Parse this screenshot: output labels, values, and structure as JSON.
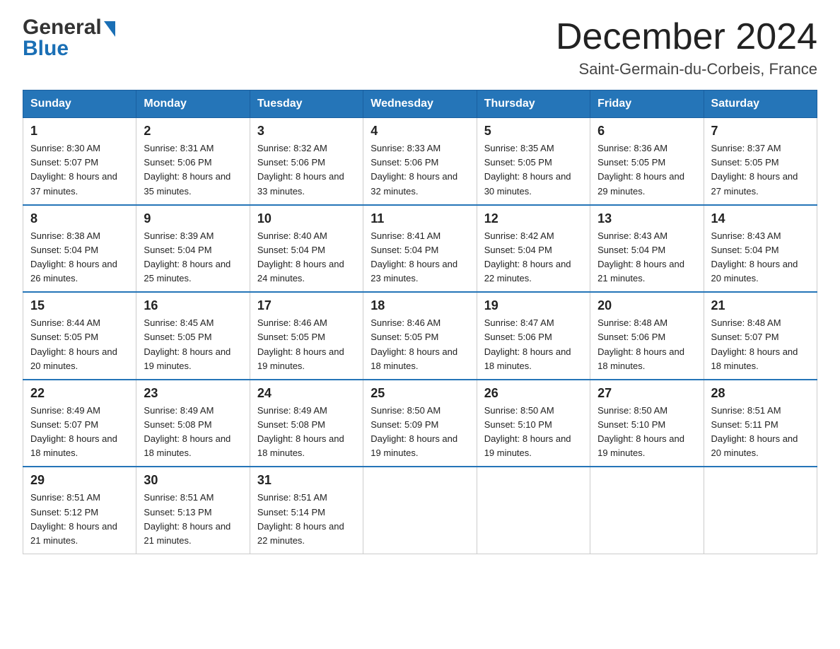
{
  "logo": {
    "text_general": "General",
    "text_blue": "Blue",
    "arrow": "▶"
  },
  "title": "December 2024",
  "location": "Saint-Germain-du-Corbeis, France",
  "days_of_week": [
    "Sunday",
    "Monday",
    "Tuesday",
    "Wednesday",
    "Thursday",
    "Friday",
    "Saturday"
  ],
  "weeks": [
    [
      {
        "day": "1",
        "sunrise": "8:30 AM",
        "sunset": "5:07 PM",
        "daylight": "8 hours and 37 minutes."
      },
      {
        "day": "2",
        "sunrise": "8:31 AM",
        "sunset": "5:06 PM",
        "daylight": "8 hours and 35 minutes."
      },
      {
        "day": "3",
        "sunrise": "8:32 AM",
        "sunset": "5:06 PM",
        "daylight": "8 hours and 33 minutes."
      },
      {
        "day": "4",
        "sunrise": "8:33 AM",
        "sunset": "5:06 PM",
        "daylight": "8 hours and 32 minutes."
      },
      {
        "day": "5",
        "sunrise": "8:35 AM",
        "sunset": "5:05 PM",
        "daylight": "8 hours and 30 minutes."
      },
      {
        "day": "6",
        "sunrise": "8:36 AM",
        "sunset": "5:05 PM",
        "daylight": "8 hours and 29 minutes."
      },
      {
        "day": "7",
        "sunrise": "8:37 AM",
        "sunset": "5:05 PM",
        "daylight": "8 hours and 27 minutes."
      }
    ],
    [
      {
        "day": "8",
        "sunrise": "8:38 AM",
        "sunset": "5:04 PM",
        "daylight": "8 hours and 26 minutes."
      },
      {
        "day": "9",
        "sunrise": "8:39 AM",
        "sunset": "5:04 PM",
        "daylight": "8 hours and 25 minutes."
      },
      {
        "day": "10",
        "sunrise": "8:40 AM",
        "sunset": "5:04 PM",
        "daylight": "8 hours and 24 minutes."
      },
      {
        "day": "11",
        "sunrise": "8:41 AM",
        "sunset": "5:04 PM",
        "daylight": "8 hours and 23 minutes."
      },
      {
        "day": "12",
        "sunrise": "8:42 AM",
        "sunset": "5:04 PM",
        "daylight": "8 hours and 22 minutes."
      },
      {
        "day": "13",
        "sunrise": "8:43 AM",
        "sunset": "5:04 PM",
        "daylight": "8 hours and 21 minutes."
      },
      {
        "day": "14",
        "sunrise": "8:43 AM",
        "sunset": "5:04 PM",
        "daylight": "8 hours and 20 minutes."
      }
    ],
    [
      {
        "day": "15",
        "sunrise": "8:44 AM",
        "sunset": "5:05 PM",
        "daylight": "8 hours and 20 minutes."
      },
      {
        "day": "16",
        "sunrise": "8:45 AM",
        "sunset": "5:05 PM",
        "daylight": "8 hours and 19 minutes."
      },
      {
        "day": "17",
        "sunrise": "8:46 AM",
        "sunset": "5:05 PM",
        "daylight": "8 hours and 19 minutes."
      },
      {
        "day": "18",
        "sunrise": "8:46 AM",
        "sunset": "5:05 PM",
        "daylight": "8 hours and 18 minutes."
      },
      {
        "day": "19",
        "sunrise": "8:47 AM",
        "sunset": "5:06 PM",
        "daylight": "8 hours and 18 minutes."
      },
      {
        "day": "20",
        "sunrise": "8:48 AM",
        "sunset": "5:06 PM",
        "daylight": "8 hours and 18 minutes."
      },
      {
        "day": "21",
        "sunrise": "8:48 AM",
        "sunset": "5:07 PM",
        "daylight": "8 hours and 18 minutes."
      }
    ],
    [
      {
        "day": "22",
        "sunrise": "8:49 AM",
        "sunset": "5:07 PM",
        "daylight": "8 hours and 18 minutes."
      },
      {
        "day": "23",
        "sunrise": "8:49 AM",
        "sunset": "5:08 PM",
        "daylight": "8 hours and 18 minutes."
      },
      {
        "day": "24",
        "sunrise": "8:49 AM",
        "sunset": "5:08 PM",
        "daylight": "8 hours and 18 minutes."
      },
      {
        "day": "25",
        "sunrise": "8:50 AM",
        "sunset": "5:09 PM",
        "daylight": "8 hours and 19 minutes."
      },
      {
        "day": "26",
        "sunrise": "8:50 AM",
        "sunset": "5:10 PM",
        "daylight": "8 hours and 19 minutes."
      },
      {
        "day": "27",
        "sunrise": "8:50 AM",
        "sunset": "5:10 PM",
        "daylight": "8 hours and 19 minutes."
      },
      {
        "day": "28",
        "sunrise": "8:51 AM",
        "sunset": "5:11 PM",
        "daylight": "8 hours and 20 minutes."
      }
    ],
    [
      {
        "day": "29",
        "sunrise": "8:51 AM",
        "sunset": "5:12 PM",
        "daylight": "8 hours and 21 minutes."
      },
      {
        "day": "30",
        "sunrise": "8:51 AM",
        "sunset": "5:13 PM",
        "daylight": "8 hours and 21 minutes."
      },
      {
        "day": "31",
        "sunrise": "8:51 AM",
        "sunset": "5:14 PM",
        "daylight": "8 hours and 22 minutes."
      },
      null,
      null,
      null,
      null
    ]
  ]
}
